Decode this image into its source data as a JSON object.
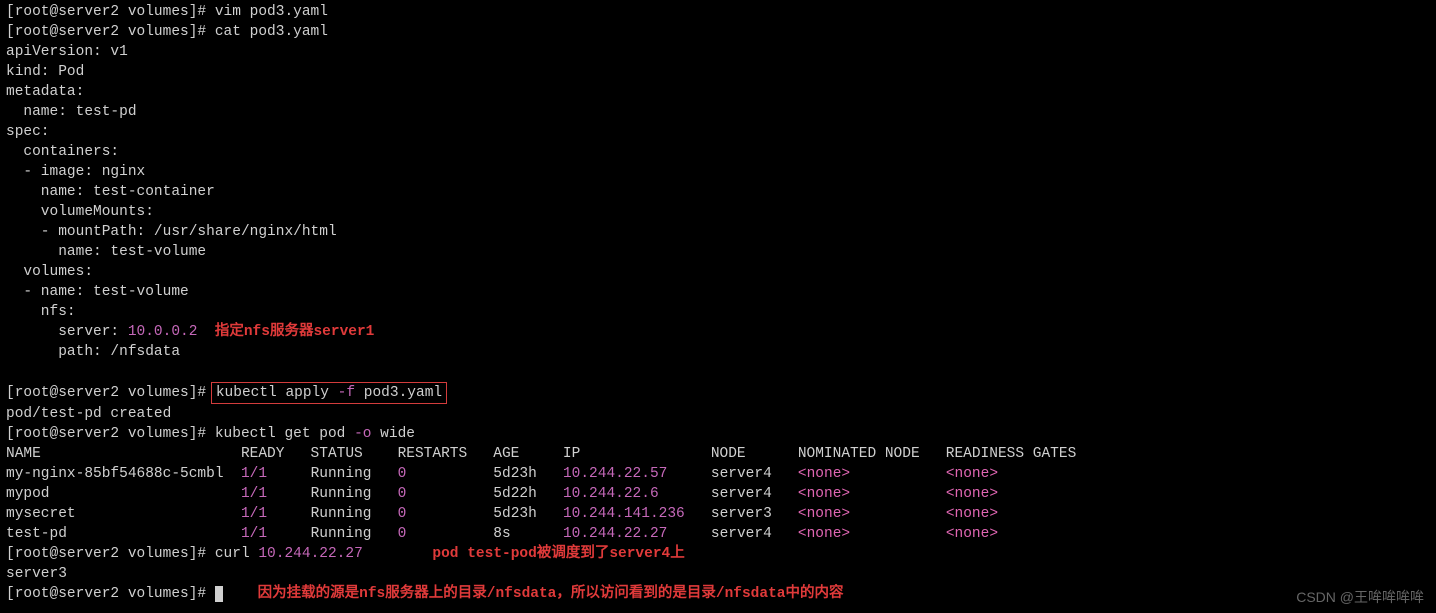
{
  "prompt": "[root@server2 volumes]# ",
  "cmds": {
    "vim": "vim pod3.yaml",
    "cat": "cat pod3.yaml",
    "apply": "kubectl apply ",
    "apply_flag": "-f",
    "apply_file": " pod3.yaml",
    "get": "kubectl get pod ",
    "get_flag": "-o",
    "get_wide": " wide",
    "curl": "curl ",
    "curl_ip": "10.244.22.27"
  },
  "yaml_lines": [
    "apiVersion: v1",
    "kind: Pod",
    "metadata:",
    "  name: test-pd",
    "spec:",
    "  containers:",
    "  - image: nginx",
    "    name: test-container",
    "    volumeMounts:",
    "    - mountPath: /usr/share/nginx/html",
    "      name: test-volume",
    "  volumes:",
    "  - name: test-volume",
    "    nfs:"
  ],
  "yaml_server_prefix": "      server: ",
  "yaml_server_ip": "10.0.0.2",
  "yaml_path_line": "      path: /nfsdata",
  "anno1": "指定nfs服务器server1",
  "apply_result": "pod/test-pd created",
  "table_header": "NAME                       READY   STATUS    RESTARTS   AGE     IP               NODE      NOMINATED NODE   READINESS GATES",
  "rows": [
    {
      "c0": "my-nginx-85bf54688c-5cmbl  ",
      "c1": "1/1",
      "c2": "     Running   ",
      "c3": "0",
      "c4": "          5d23h   ",
      "ip": "10.244.22.57",
      "c5": "     server4   ",
      "n1": "<none>",
      "c6": "           ",
      "n2": "<none>"
    },
    {
      "c0": "mypod                      ",
      "c1": "1/1",
      "c2": "     Running   ",
      "c3": "0",
      "c4": "          5d22h   ",
      "ip": "10.244.22.6",
      "c5": "      server4   ",
      "n1": "<none>",
      "c6": "           ",
      "n2": "<none>"
    },
    {
      "c0": "mysecret                   ",
      "c1": "1/1",
      "c2": "     Running   ",
      "c3": "0",
      "c4": "          5d23h   ",
      "ip": "10.244.141.236",
      "c5": "   server3   ",
      "n1": "<none>",
      "c6": "           ",
      "n2": "<none>"
    },
    {
      "c0": "test-pd                    ",
      "c1": "1/1",
      "c2": "     Running   ",
      "c3": "0",
      "c4": "          8s      ",
      "ip": "10.244.22.27",
      "c5": "     server4   ",
      "n1": "<none>",
      "c6": "           ",
      "n2": "<none>"
    }
  ],
  "anno2": "pod test-pod被调度到了server4上",
  "curl_out": "server3",
  "anno3": "因为挂载的源是nfs服务器上的目录/nfsdata，所以访问看到的是目录/nfsdata中的内容",
  "watermark": "CSDN @王哞哞哞哞"
}
